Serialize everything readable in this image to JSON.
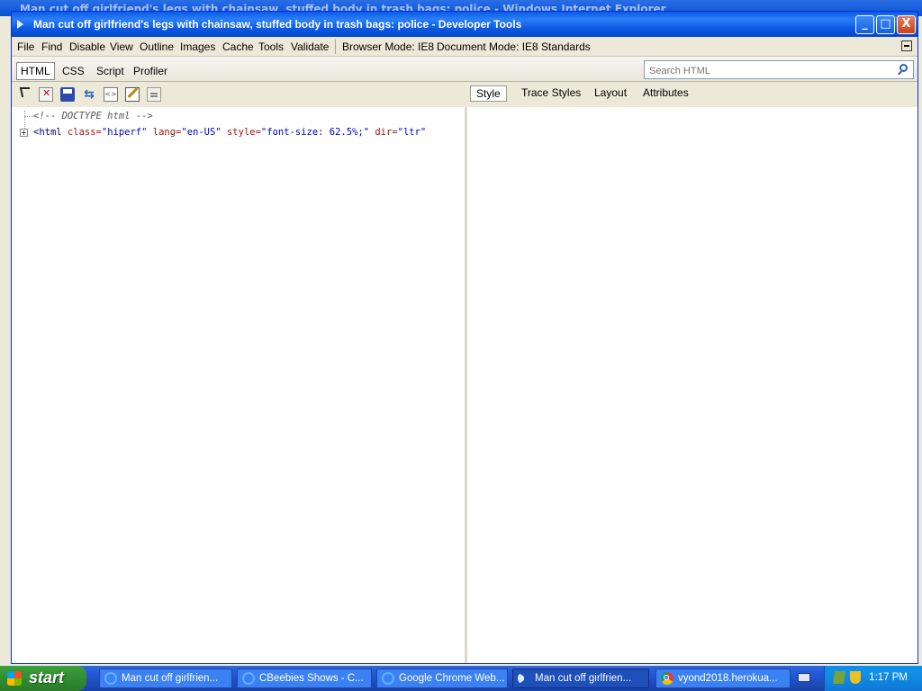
{
  "background_window": {
    "title": "Man cut off girlfriend's legs with chainsaw, stuffed body in trash bags: police - Windows Internet Explorer"
  },
  "window": {
    "title": "Man cut off girlfriend's legs with chainsaw, stuffed body in trash bags: police - Developer Tools",
    "controls": {
      "minimize": "_",
      "maximize": "□",
      "close": "X"
    }
  },
  "menubar": {
    "items": [
      "File",
      "Find",
      "Disable",
      "View",
      "Outline",
      "Images",
      "Cache",
      "Tools",
      "Validate"
    ],
    "browser_mode": "Browser Mode: IE8",
    "document_mode": "Document Mode: IE8 Standards"
  },
  "tabs": {
    "items": [
      "HTML",
      "CSS",
      "Script",
      "Profiler"
    ],
    "active": "HTML"
  },
  "search": {
    "placeholder": "Search HTML",
    "icon": "search-icon"
  },
  "toolbar": {
    "icons": [
      "select-element-icon",
      "clear-icon",
      "save-icon",
      "refresh-icon",
      "view-source-icon",
      "edit-icon",
      "word-wrap-icon"
    ]
  },
  "style_tabs": {
    "items": [
      "Style",
      "Trace Styles",
      "Layout",
      "Attributes"
    ],
    "active": "Style"
  },
  "dom_tree": {
    "doctype": "<!-- DOCTYPE html -->",
    "html_node": {
      "open": "<html",
      "attr1_name": " class=",
      "attr1_value": "\"hiperf\"",
      "attr2_name": " lang=",
      "attr2_value": "\"en-US\"",
      "attr3_name": " style=",
      "attr3_value": "\"font-size: 62.5%;\"",
      "attr4_name": " dir=",
      "attr4_value": "\"ltr\"",
      "expander": "+"
    }
  },
  "taskbar": {
    "start_label": "start",
    "tasks": [
      {
        "label": "Man cut off girlfrien...",
        "icon": "ie-icon"
      },
      {
        "label": "CBeebies Shows - C...",
        "icon": "ie-icon"
      },
      {
        "label": "Google Chrome Web...",
        "icon": "ie-icon"
      },
      {
        "label": "Man cut off girlfrien...",
        "icon": "developer-tools-icon"
      },
      {
        "label": "vyond2018.herokua...",
        "icon": "chrome-icon"
      }
    ],
    "active_task": 3,
    "clock": "1:17 PM"
  }
}
